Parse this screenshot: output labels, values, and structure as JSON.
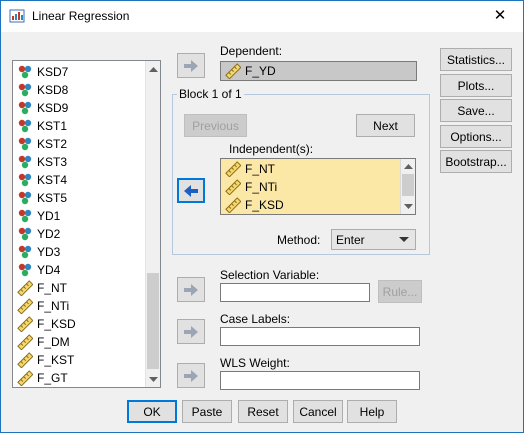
{
  "window": {
    "title": "Linear Regression",
    "close_glyph": "✕"
  },
  "source_vars": [
    {
      "label": "KSD7",
      "icon": "nominal-icon"
    },
    {
      "label": "KSD8",
      "icon": "nominal-icon"
    },
    {
      "label": "KSD9",
      "icon": "nominal-icon"
    },
    {
      "label": "KST1",
      "icon": "nominal-icon"
    },
    {
      "label": "KST2",
      "icon": "nominal-icon"
    },
    {
      "label": "KST3",
      "icon": "nominal-icon"
    },
    {
      "label": "KST4",
      "icon": "nominal-icon"
    },
    {
      "label": "KST5",
      "icon": "nominal-icon"
    },
    {
      "label": "YD1",
      "icon": "nominal-icon"
    },
    {
      "label": "YD2",
      "icon": "nominal-icon"
    },
    {
      "label": "YD3",
      "icon": "nominal-icon"
    },
    {
      "label": "YD4",
      "icon": "nominal-icon"
    },
    {
      "label": "F_NT",
      "icon": "scale-icon"
    },
    {
      "label": "F_NTi",
      "icon": "scale-icon"
    },
    {
      "label": "F_KSD",
      "icon": "scale-icon"
    },
    {
      "label": "F_DM",
      "icon": "scale-icon"
    },
    {
      "label": "F_KST",
      "icon": "scale-icon"
    },
    {
      "label": "F_GT",
      "icon": "scale-icon"
    }
  ],
  "dependent": {
    "label": "Dependent:",
    "value": "F_YD"
  },
  "block": {
    "title": "Block 1 of 1",
    "previous": "Previous",
    "next": "Next"
  },
  "independents": {
    "label": "Independent(s):",
    "items": [
      "F_NT",
      "F_NTi",
      "F_KSD"
    ]
  },
  "method": {
    "label": "Method:",
    "value": "Enter"
  },
  "selection": {
    "label": "Selection Variable:",
    "rule": "Rule..."
  },
  "case_labels": {
    "label": "Case Labels:"
  },
  "wls": {
    "label": "WLS Weight:"
  },
  "side_buttons": [
    "Statistics...",
    "Plots...",
    "Save...",
    "Options...",
    "Bootstrap..."
  ],
  "footer_buttons": [
    "OK",
    "Paste",
    "Reset",
    "Cancel",
    "Help"
  ],
  "colors": {
    "accent": "#0078d7",
    "list_highlight": "#fbe8a6",
    "arrow_blue": "#1f5fbf"
  }
}
